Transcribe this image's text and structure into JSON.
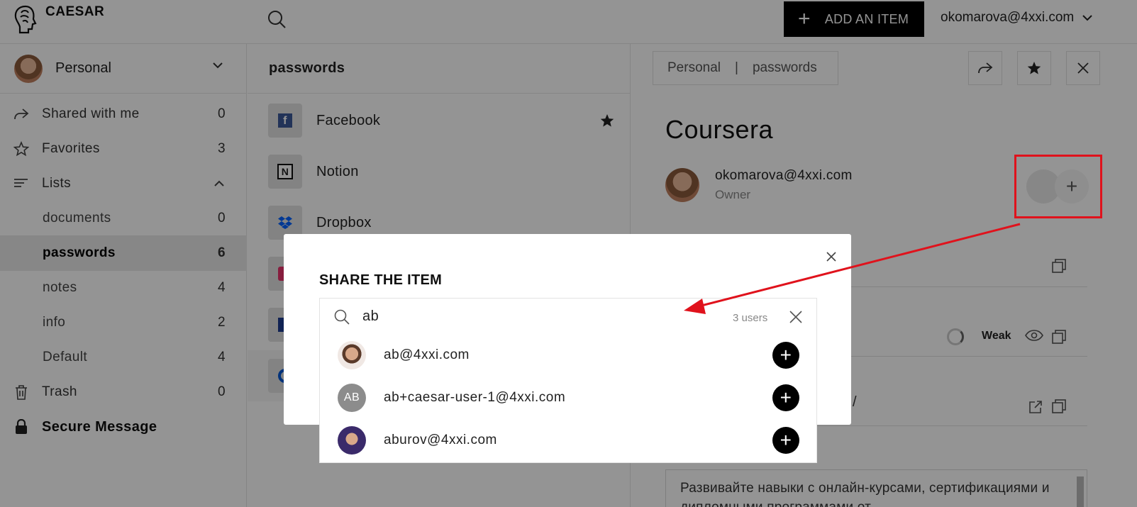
{
  "app": {
    "name": "CAESAR"
  },
  "header": {
    "add_button_label": "ADD AN ITEM",
    "user_email": "okomarova@4xxi.com"
  },
  "sidebar": {
    "vault_name": "Personal",
    "items": [
      {
        "label": "Shared with me",
        "count": "0",
        "icon": "share-icon"
      },
      {
        "label": "Favorites",
        "count": "3",
        "icon": "star-icon"
      },
      {
        "label": "Lists",
        "count": "",
        "icon": "lists-icon"
      },
      {
        "label": "documents",
        "count": "0"
      },
      {
        "label": "passwords",
        "count": "6"
      },
      {
        "label": "notes",
        "count": "4"
      },
      {
        "label": "info",
        "count": "2"
      },
      {
        "label": "Default",
        "count": "4"
      },
      {
        "label": "Trash",
        "count": "0",
        "icon": "trash-icon"
      },
      {
        "label": "Secure Message",
        "count": "",
        "icon": "lock-icon"
      }
    ]
  },
  "list": {
    "title": "passwords",
    "items": [
      {
        "name": "Facebook",
        "favorite": true
      },
      {
        "name": "Notion"
      },
      {
        "name": "Dropbox"
      }
    ]
  },
  "detail": {
    "breadcrumb": [
      "Personal",
      "passwords"
    ],
    "title": "Coursera",
    "owner_email": "okomarova@4xxi.com",
    "owner_role": "Owner",
    "strength": "Weak",
    "url_tail": "/",
    "notes": "Развивайте навыки с онлайн-курсами, сертификациями и дипломными программами от"
  },
  "modal": {
    "title": "SHARE THE ITEM",
    "search_value": "ab",
    "result_count": "3 users",
    "users": [
      {
        "email": "ab@4xxi.com",
        "initials": ""
      },
      {
        "email": "ab+caesar-user-1@4xxi.com",
        "initials": "AB"
      },
      {
        "email": "aburov@4xxi.com",
        "initials": ""
      }
    ]
  },
  "colors": {
    "highlight": "#e0121c",
    "accent": "#000000"
  }
}
